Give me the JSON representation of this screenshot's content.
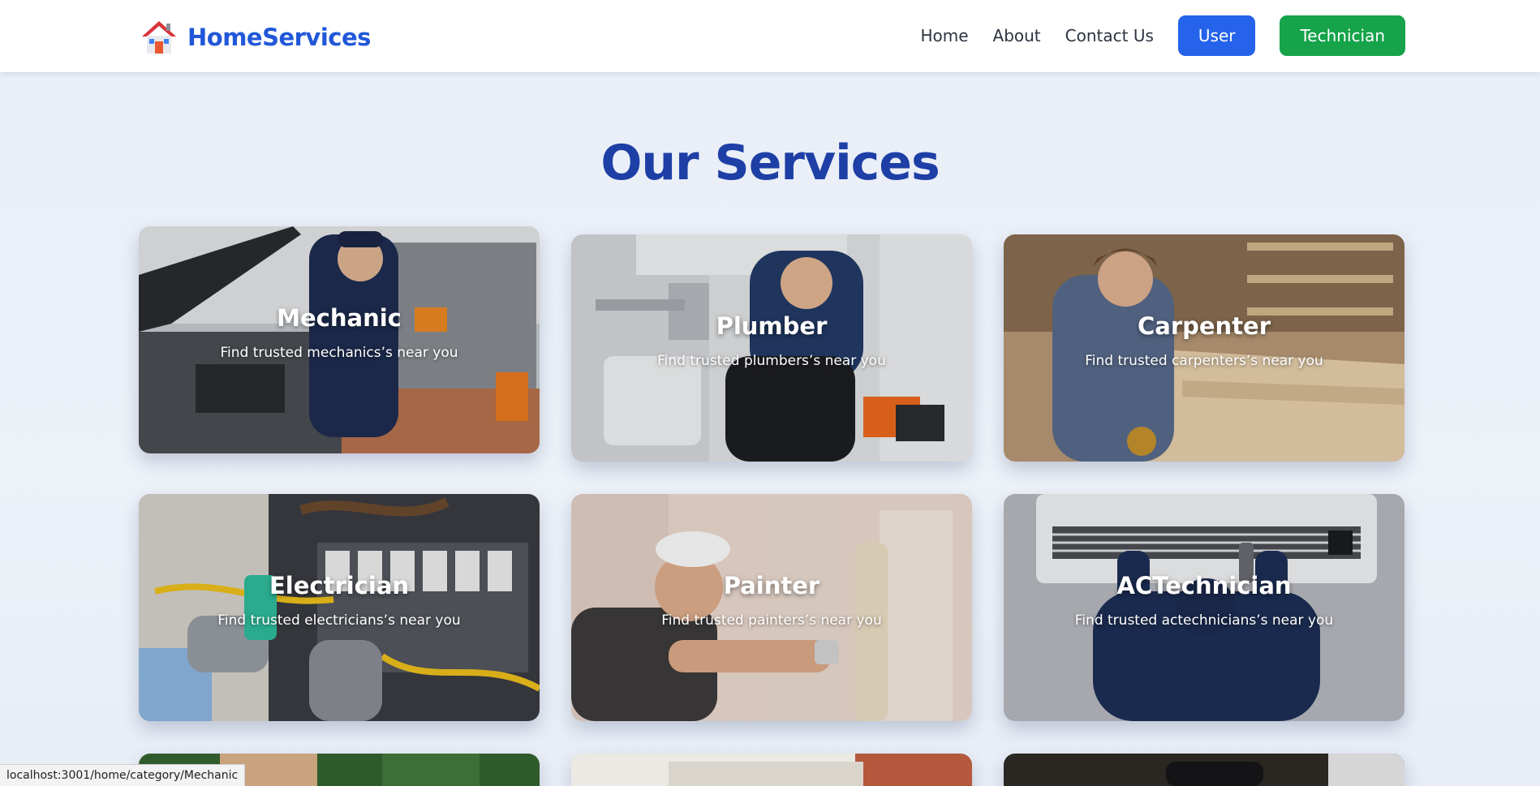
{
  "brand": {
    "name": "HomeServices",
    "icon": "house-icon"
  },
  "nav": {
    "links": [
      "Home",
      "About",
      "Contact Us"
    ],
    "user_button": "User",
    "technician_button": "Technician"
  },
  "main": {
    "title": "Our Services",
    "cards": [
      {
        "title": "Mechanic",
        "subtitle": "Find trusted mechanicsʼs near you"
      },
      {
        "title": "Plumber",
        "subtitle": "Find trusted plumbersʼs near you"
      },
      {
        "title": "Carpenter",
        "subtitle": "Find trusted carpentersʼs near you"
      },
      {
        "title": "Electrician",
        "subtitle": "Find trusted electriciansʼs near you"
      },
      {
        "title": "Painter",
        "subtitle": "Find trusted paintersʼs near you"
      },
      {
        "title": "ACTechnician",
        "subtitle": "Find trusted actechniciansʼs near you"
      }
    ]
  },
  "status_bar": {
    "url": "localhost:3001/home/category/Mechanic"
  },
  "colors": {
    "brand": "#2158d8",
    "title": "#1e3fa6",
    "user_button": "#2563eb",
    "technician_button": "#16a34a"
  }
}
